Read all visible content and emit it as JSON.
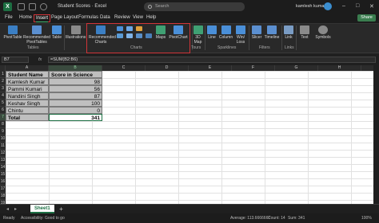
{
  "titlebar": {
    "logo": "X",
    "autosave": "AutoSave",
    "doc_title": "Student Scores · Excel",
    "search_placeholder": "Search",
    "user": "kamlesh kumar",
    "min": "–",
    "max": "□",
    "close": "✕"
  },
  "menubar": {
    "items": [
      "File",
      "Home",
      "Insert",
      "Page Layout",
      "Formulas",
      "Data",
      "Review",
      "View",
      "Help"
    ],
    "share": "Share"
  },
  "ribbon": {
    "pivottable": "PivotTable",
    "recommended_pivottables": "Recommended PivotTables",
    "table": "Table",
    "tables_group": "Tables",
    "illustrations": "Illustrations",
    "recommended_charts": "Recommended Charts",
    "maps": "Maps",
    "pivotchart": "PivotChart",
    "charts_group": "Charts",
    "map3d": "3D Map",
    "tours_group": "Tours",
    "line": "Line",
    "column": "Column",
    "winloss": "Win/ Loss",
    "sparklines_group": "Sparklines",
    "slicer": "Slicer",
    "timeline": "Timeline",
    "filters_group": "Filters",
    "link": "Link",
    "links_group": "Links",
    "text": "Text",
    "symbols": "Symbols"
  },
  "formula": {
    "namebox": "B7",
    "fx": "fx",
    "content": "=SUM(B2:B6)"
  },
  "grid": {
    "columns": [
      "A",
      "B",
      "C",
      "D",
      "E",
      "F",
      "G",
      "H",
      "I"
    ],
    "rows": [
      "1",
      "2",
      "3",
      "4",
      "5",
      "6",
      "7",
      "8",
      "9",
      "10",
      "11",
      "12",
      "13",
      "14",
      "15",
      "16",
      "17",
      "18",
      "19"
    ],
    "selected_col": "B",
    "selected_row": "7",
    "header": {
      "name": "Student Name",
      "score": "Score in Science"
    },
    "data": [
      {
        "name": "Kamlesh Kumar",
        "score": "98"
      },
      {
        "name": "Pammi Kumari",
        "score": "56"
      },
      {
        "name": "Nandini Singh",
        "score": "87"
      },
      {
        "name": "Keshav Singh",
        "score": "100"
      },
      {
        "name": "Chintu",
        "score": "0"
      }
    ],
    "total": {
      "label": "Total",
      "value": "341"
    }
  },
  "tabs": {
    "prev": "◂",
    "next": "▸",
    "sheet": "Sheet1",
    "add": "+"
  },
  "status": {
    "ready": "Ready",
    "accessibility": "Accessibility: Good to go",
    "average": "Average: 113.6666667",
    "count": "Count: 14",
    "sum": "Sum: 341",
    "zoom": "100%"
  }
}
